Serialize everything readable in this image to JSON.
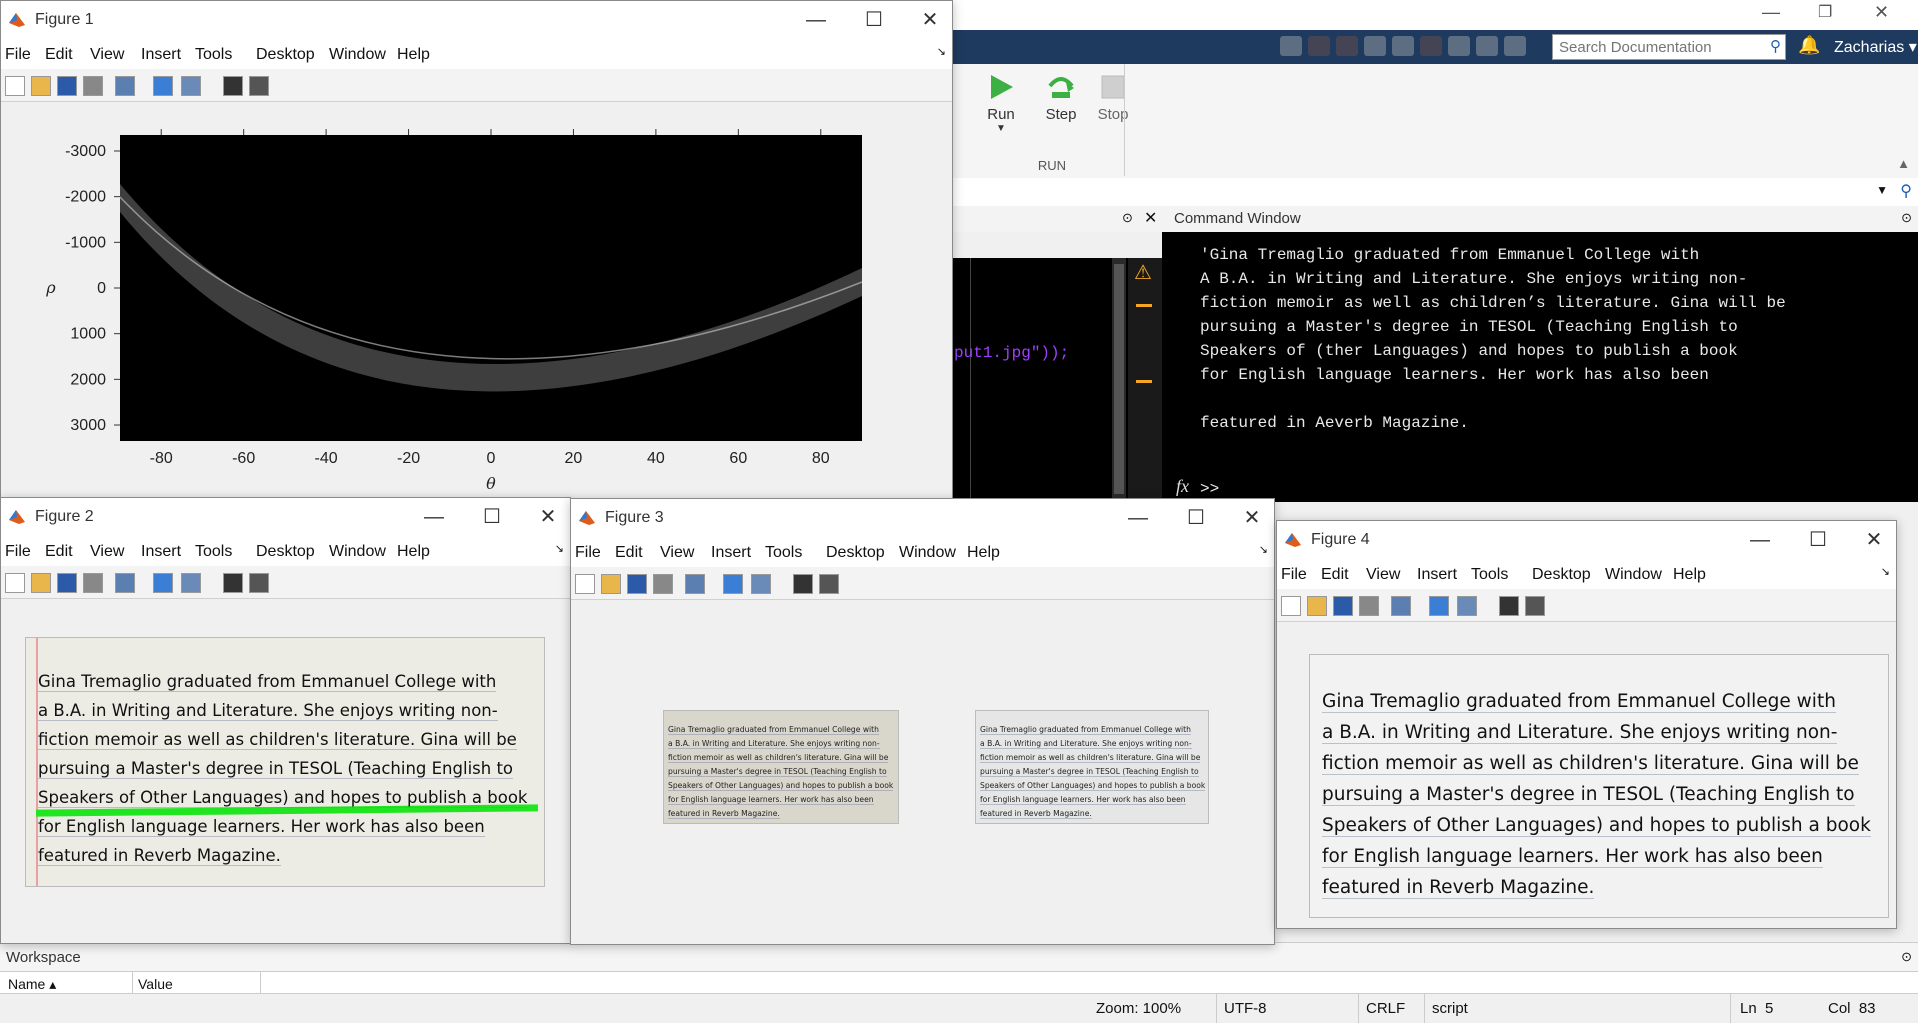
{
  "figure_windows": [
    {
      "key": "fig1",
      "title": "Figure 1"
    },
    {
      "key": "fig2",
      "title": "Figure 2"
    },
    {
      "key": "fig3",
      "title": "Figure 3"
    },
    {
      "key": "fig4",
      "title": "Figure 4"
    }
  ],
  "menu": [
    "File",
    "Edit",
    "View",
    "Insert",
    "Tools",
    "Desktop",
    "Window",
    "Help"
  ],
  "toolbar_icons": [
    "new-file-icon",
    "open-folder-icon",
    "save-icon",
    "print-icon",
    "link-plot-icon",
    "insert-colorbar-icon",
    "insert-legend-icon",
    "pointer-icon",
    "property-editor-icon"
  ],
  "window_controls": {
    "minimize": "—",
    "maximize": "☐",
    "close": "✕"
  },
  "figure1_plot": {
    "xlabel": "θ",
    "ylabel": "ρ",
    "xticks": [
      "-80",
      "-60",
      "-40",
      "-20",
      "0",
      "20",
      "40",
      "60",
      "80"
    ],
    "yticks": [
      "-3000",
      "-2000",
      "-1000",
      "0",
      "1000",
      "2000",
      "3000"
    ]
  },
  "matlab": {
    "search_placeholder": "Search Documentation",
    "user": "Zacharias",
    "run_section": {
      "run": "Run",
      "step": "Step",
      "stop": "Stop",
      "group": "RUN"
    },
    "editor_code": "put1.jpg\"));",
    "command_window_title": "Command Window",
    "command_prompt": ">>",
    "fx": "fx",
    "command_output": [
      "'Gina Tremaglio graduated from Emmanuel College with",
      "A B.A. in Writing and Literature. She enjoys writing non-",
      "fiction memoir as well as children’s literature. Gina will be",
      "pursuing a Master's degree in TESOL (Teaching English to",
      "Speakers of (ther Languages) and hopes to publish a book",
      "for English language learners. Her work has also been",
      "",
      "featured in Aeverb Magazine."
    ],
    "workspace_title": "Workspace",
    "workspace_columns": [
      "Name ▴",
      "Value"
    ]
  },
  "statusbar": {
    "zoom": "Zoom: 100%",
    "encoding": "UTF-8",
    "eol": "CRLF",
    "type": "script",
    "ln": "Ln  5",
    "col": "Col  83"
  },
  "note_text": [
    "Gina Tremaglio graduated from Emmanuel College with",
    "a B.A. in Writing and Literature. She enjoys writing non-",
    "fiction memoir as well as children's literature. Gina will be",
    "pursuing a Master's degree in TESOL (Teaching English to",
    "Speakers of Other Languages) and hopes to publish a book",
    "for English language learners. Her work has also been",
    "featured in Reverb Magazine."
  ],
  "colors": {
    "matlab_strip": "#1f3a5f",
    "highlight": "#22e522",
    "warning": "#f5a623"
  }
}
